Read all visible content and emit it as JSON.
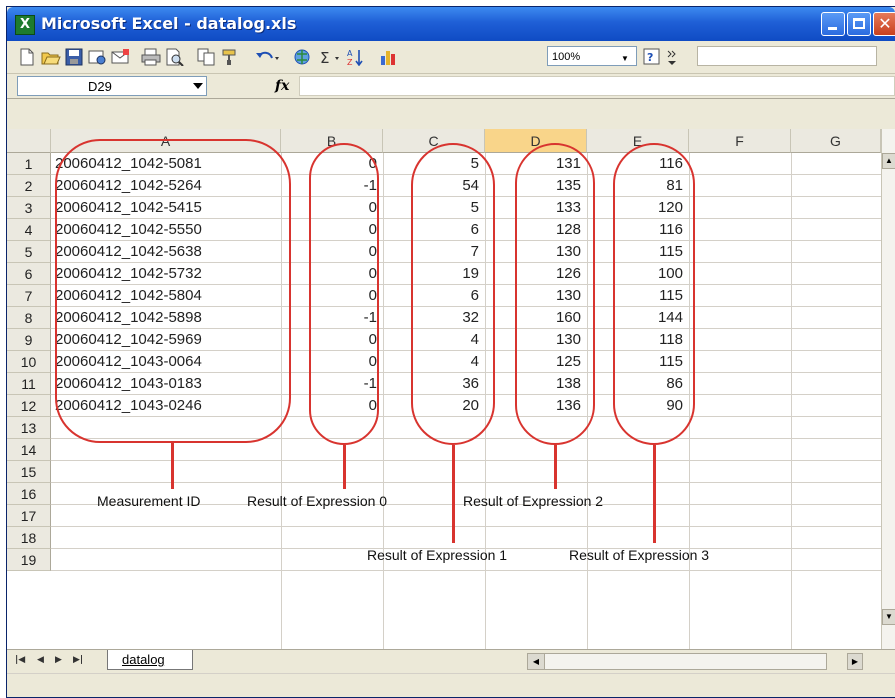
{
  "window": {
    "title": "Microsoft Excel - datalog.xls",
    "app_icon": "X"
  },
  "toolbar": {
    "zoom_value": "100%",
    "icons": [
      "new-icon",
      "open-icon",
      "save-icon",
      "permission-icon",
      "email-icon",
      "print-icon",
      "print-preview-icon",
      "copy-icon",
      "format-painter-icon",
      "undo-icon",
      "insert-hyperlink-icon",
      "autosum-icon",
      "sort-ascending-icon",
      "chart-wizard-icon",
      "zoom-dropdown",
      "help-icon",
      "toolbar-options-icon"
    ]
  },
  "formula_bar": {
    "name_box": "D29",
    "fx": "fx",
    "formula": ""
  },
  "columns": [
    "A",
    "B",
    "C",
    "D",
    "E",
    "F",
    "G"
  ],
  "row_numbers": [
    "1",
    "2",
    "3",
    "4",
    "5",
    "6",
    "7",
    "8",
    "9",
    "10",
    "11",
    "12",
    "13",
    "14",
    "15",
    "16",
    "17",
    "18",
    "19"
  ],
  "rows": [
    {
      "a": "20060412_1042-5081",
      "b": "0",
      "c": "5",
      "d": "131",
      "e": "116"
    },
    {
      "a": "20060412_1042-5264",
      "b": "-1",
      "c": "54",
      "d": "135",
      "e": "81"
    },
    {
      "a": "20060412_1042-5415",
      "b": "0",
      "c": "5",
      "d": "133",
      "e": "120"
    },
    {
      "a": "20060412_1042-5550",
      "b": "0",
      "c": "6",
      "d": "128",
      "e": "116"
    },
    {
      "a": "20060412_1042-5638",
      "b": "0",
      "c": "7",
      "d": "130",
      "e": "115"
    },
    {
      "a": "20060412_1042-5732",
      "b": "0",
      "c": "19",
      "d": "126",
      "e": "100"
    },
    {
      "a": "20060412_1042-5804",
      "b": "0",
      "c": "6",
      "d": "130",
      "e": "115"
    },
    {
      "a": "20060412_1042-5898",
      "b": "-1",
      "c": "32",
      "d": "160",
      "e": "144"
    },
    {
      "a": "20060412_1042-5969",
      "b": "0",
      "c": "4",
      "d": "130",
      "e": "118"
    },
    {
      "a": "20060412_1043-0064",
      "b": "0",
      "c": "4",
      "d": "125",
      "e": "115"
    },
    {
      "a": "20060412_1043-0183",
      "b": "-1",
      "c": "36",
      "d": "138",
      "e": "86"
    },
    {
      "a": "20060412_1043-0246",
      "b": "0",
      "c": "20",
      "d": "136",
      "e": "90"
    }
  ],
  "annotations": {
    "measurement_id": "Measurement ID",
    "expr0": "Result of Expression 0",
    "expr1": "Result of Expression 1",
    "expr2": "Result of Expression 2",
    "expr3": "Result of Expression 3"
  },
  "annotation_color": "#d8342f",
  "sheet_tabs": [
    "datalog"
  ]
}
